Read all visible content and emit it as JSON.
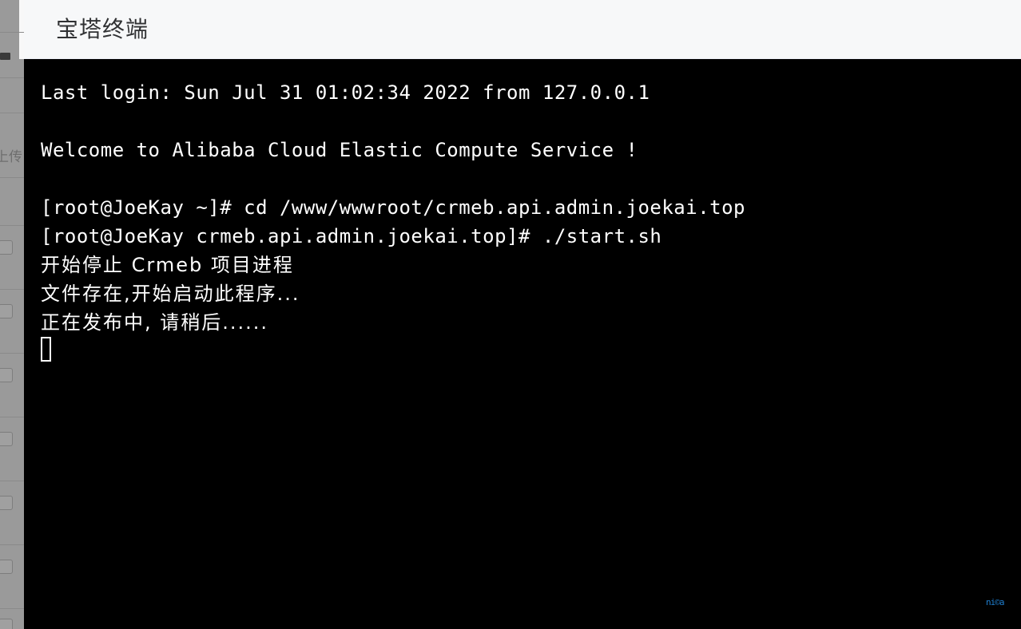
{
  "window": {
    "title": "宝塔终端",
    "header_bg": "#f7f8f9",
    "terminal_bg": "#000000",
    "terminal_fg": "#ffffff"
  },
  "backdrop": {
    "bg_color": "#9a9a9a",
    "partial_label": "上传",
    "row_count": 9
  },
  "terminal": {
    "lines": [
      {
        "id": "line-last-login",
        "text": "Last login: Sun Jul 31 01:02:34 2022 from 127.0.0.1",
        "cjk": false
      },
      {
        "id": "line-blank-1",
        "text": " ",
        "cjk": false
      },
      {
        "id": "line-welcome",
        "text": "Welcome to Alibaba Cloud Elastic Compute Service !",
        "cjk": false
      },
      {
        "id": "line-blank-2",
        "text": " ",
        "cjk": false
      },
      {
        "id": "line-cmd-cd",
        "text": "[root@JoeKay ~]# cd /www/wwwroot/crmeb.api.admin.joekai.top",
        "cjk": false
      },
      {
        "id": "line-cmd-start",
        "text": "[root@JoeKay crmeb.api.admin.joekai.top]# ./start.sh",
        "cjk": false
      },
      {
        "id": "line-out-stop",
        "text": "开始停止 Crmeb 项目进程",
        "cjk": true
      },
      {
        "id": "line-out-exists",
        "text": "文件存在,开始启动此程序...",
        "cjk": true
      },
      {
        "id": "line-out-publishing",
        "text": "正在发布中, 请稍后......",
        "cjk": true
      }
    ],
    "cursor_visible": true,
    "badge_text": "ni©a",
    "badge_color": "#1f7fd0"
  }
}
